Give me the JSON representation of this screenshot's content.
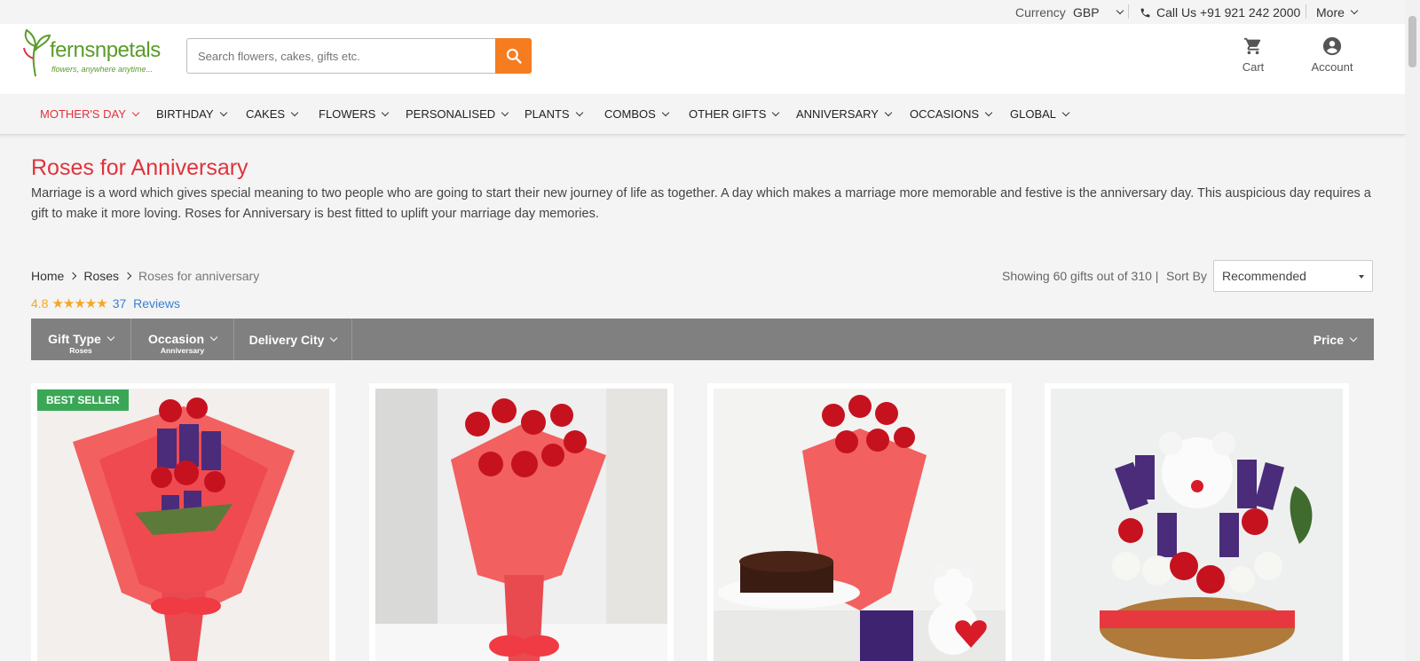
{
  "topbar": {
    "currency_label": "Currency",
    "currency_value": "GBP",
    "call_text": "Call Us +91 921 242 2000",
    "more_label": "More"
  },
  "header": {
    "logo_name": "fernsnpetals",
    "logo_tagline": "flowers, anywhere anytime...",
    "search_placeholder": "Search flowers, cakes, gifts etc.",
    "cart_label": "Cart",
    "account_label": "Account"
  },
  "nav": {
    "items": [
      {
        "label": "MOTHER'S DAY"
      },
      {
        "label": "BIRTHDAY"
      },
      {
        "label": "CAKES"
      },
      {
        "label": "FLOWERS"
      },
      {
        "label": "PERSONALISED"
      },
      {
        "label": "PLANTS"
      },
      {
        "label": "COMBOS"
      },
      {
        "label": "OTHER GIFTS"
      },
      {
        "label": "ANNIVERSARY"
      },
      {
        "label": "OCCASIONS"
      },
      {
        "label": "GLOBAL"
      }
    ]
  },
  "page": {
    "title": "Roses for Anniversary",
    "description": "Marriage is a word which gives special meaning to two people who are going to start their new journey of life as together. A day which makes a marriage more memorable and festive is the anniversary day. This auspicious day requires a gift to make it more loving. Roses for Anniversary is best fitted to uplift your marriage day memories."
  },
  "breadcrumb": {
    "home": "Home",
    "roses": "Roses",
    "current": "Roses for anniversary"
  },
  "rating": {
    "score": "4.8",
    "stars": "★★★★★",
    "count": "37",
    "reviews_label": "Reviews"
  },
  "listing": {
    "showing": "Showing 60 gifts out of 310 |",
    "sort_label": "Sort By",
    "sort_value": "Recommended"
  },
  "filters": {
    "gift_type": {
      "label": "Gift Type",
      "value": "Roses"
    },
    "occasion": {
      "label": "Occasion",
      "value": "Anniversary"
    },
    "delivery_city": {
      "label": "Delivery City"
    },
    "price": {
      "label": "Price"
    }
  },
  "products": {
    "badge": "BEST SELLER"
  },
  "colors": {
    "accent": "#e0333d",
    "search_button": "#f57c1f",
    "filter_bar": "#808080",
    "badge": "#3aa757",
    "star": "#f5a623",
    "link": "#3b7fd4"
  }
}
